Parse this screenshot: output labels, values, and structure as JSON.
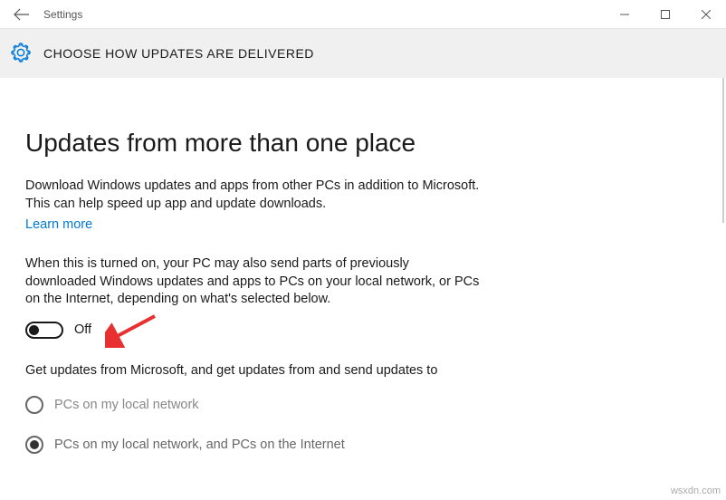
{
  "titlebar": {
    "title": "Settings"
  },
  "header": {
    "title": "CHOOSE HOW UPDATES ARE DELIVERED"
  },
  "main": {
    "page_title": "Updates from more than one place",
    "desc1": "Download Windows updates and apps from other PCs in addition to Microsoft. This can help speed up app and update downloads.",
    "learn_more": "Learn more",
    "desc2": "When this is turned on, your PC may also send parts of previously downloaded Windows updates and apps to PCs on your local network, or PCs on the Internet, depending on what's selected below.",
    "toggle_state": "Off",
    "desc3": "Get updates from Microsoft, and get updates from and send updates to",
    "radio1_label": "PCs on my local network",
    "radio2_label": "PCs on my local network, and PCs on the Internet"
  },
  "footer": {
    "mark": "wsxdn.com"
  }
}
